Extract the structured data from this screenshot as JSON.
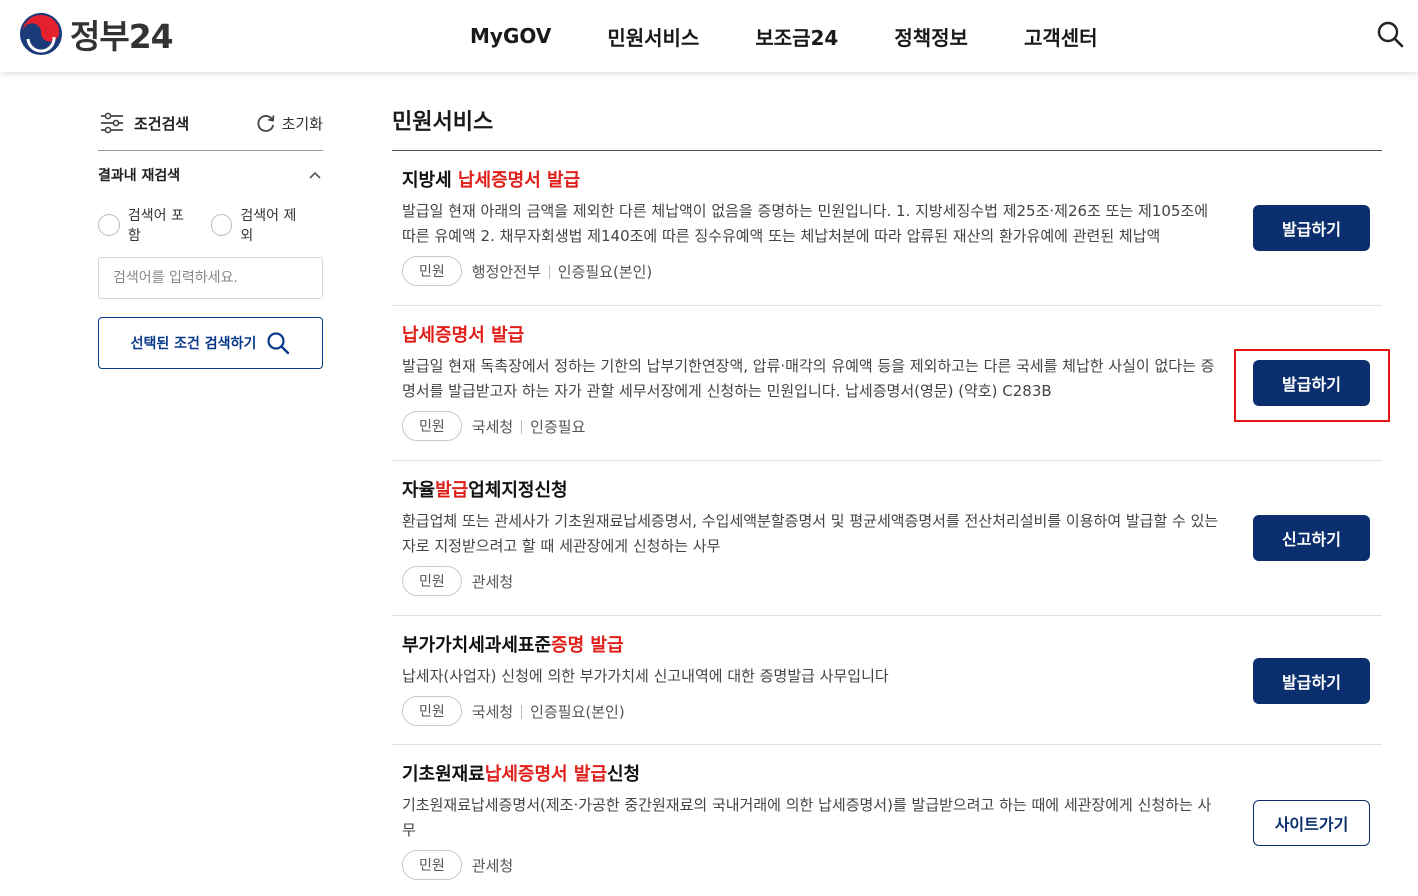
{
  "header": {
    "logo_text": "정부24",
    "nav": [
      "MyGOV",
      "민원서비스",
      "보조금24",
      "정책정보",
      "고객센터"
    ]
  },
  "sidebar": {
    "title": "조건검색",
    "reset_label": "초기화",
    "refine_title": "결과내 재검색",
    "radio_include": "검색어 포함",
    "radio_exclude": "검색어 제외",
    "search_placeholder": "검색어를 입력하세요.",
    "search_button": "선택된 조건 검색하기"
  },
  "main": {
    "title": "민원서비스",
    "items": [
      {
        "title_parts": [
          "지방세 ",
          "납세증명서 발급",
          ""
        ],
        "desc": "발급일 현재 아래의 금액을 제외한 다른 체납액이 없음을 증명하는 민원입니다. 1. 지방세징수법 제25조·제26조 또는 제105조에 따른 유예액 2. 채무자회생법 제140조에 따른 징수유예액 또는 체납처분에 따라 압류된 재산의 환가유예에 관련된 체납액",
        "tag": "민원",
        "org": "행정안전부",
        "auth": "인증필요(본인)",
        "action": "발급하기",
        "action_style": "fill"
      },
      {
        "title_parts": [
          "",
          "납세증명서 발급",
          ""
        ],
        "desc": "발급일 현재 독촉장에서 정하는 기한의 납부기한연장액, 압류·매각의 유예액 등을 제외하고는 다른 국세를 체납한 사실이 없다는 증명서를 발급받고자 하는 자가 관할 세무서장에게 신청하는 민원입니다. 납세증명서(영문) (약호) C283B",
        "tag": "민원",
        "org": "국세청",
        "auth": "인증필요",
        "action": "발급하기",
        "action_style": "fill"
      },
      {
        "title_parts": [
          "자율",
          "발급",
          "업체지정신청"
        ],
        "desc": "환급업체 또는 관세사가 기초원재료납세증명서, 수입세액분할증명서 및 평균세액증명서를 전산처리설비를 이용하여 발급할 수 있는 자로 지정받으려고 할 때 세관장에게 신청하는 사무",
        "tag": "민원",
        "org": "관세청",
        "auth": "",
        "action": "신고하기",
        "action_style": "fill"
      },
      {
        "title_parts": [
          "부가가치세과세표준",
          "증명 발급",
          ""
        ],
        "desc": "납세자(사업자) 신청에 의한 부가가치세 신고내역에 대한 증명발급 사무입니다",
        "tag": "민원",
        "org": "국세청",
        "auth": "인증필요(본인)",
        "action": "발급하기",
        "action_style": "fill"
      },
      {
        "title_parts": [
          "기초원재료",
          "납세증명서 발급",
          "신청"
        ],
        "desc": "기초원재료납세증명서(제조·가공한 중간원재료의 국내거래에 의한 납세증명서)를 발급받으려고 하는 때에 세관장에게 신청하는 사무",
        "tag": "민원",
        "org": "관세청",
        "auth": "",
        "action": "사이트가기",
        "action_style": "line"
      }
    ]
  },
  "colors": {
    "primary": "#0b2f6e",
    "highlight": "#e0201b",
    "annotation": "#e01515"
  }
}
